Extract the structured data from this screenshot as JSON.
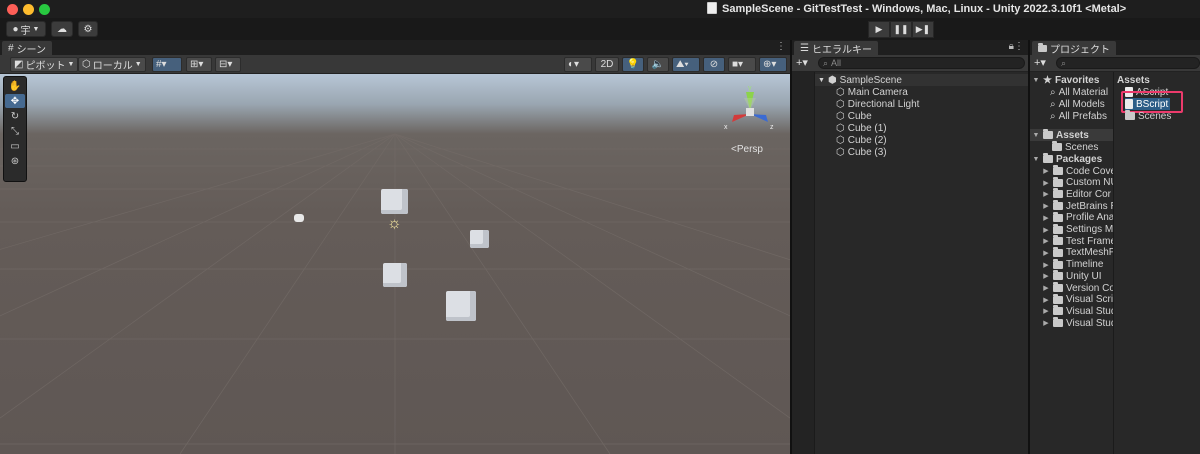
{
  "window": {
    "title": "SampleScene - GitTestTest - Windows, Mac, Linux - Unity 2022.3.10f1 <Metal>"
  },
  "toolbar": {
    "account_label": "宇"
  },
  "scene": {
    "tab_label": "シーン",
    "pivot_label": "ピボット",
    "local_label": "ローカル",
    "mode_2d": "2D",
    "persp_label": "<Persp"
  },
  "hierarchy": {
    "tab_label": "ヒエラルキー",
    "search_placeholder": "All",
    "scene_name": "SampleScene",
    "items": [
      "Main Camera",
      "Directional Light",
      "Cube",
      "Cube (1)",
      "Cube (2)",
      "Cube (3)"
    ]
  },
  "project": {
    "tab_label": "プロジェクト",
    "favorites_label": "Favorites",
    "favorites": [
      "All Material",
      "All Models",
      "All Prefabs"
    ],
    "assets_label": "Assets",
    "assets_children": [
      "Scenes"
    ],
    "packages_label": "Packages",
    "packages": [
      "Code Cove",
      "Custom NU",
      "Editor Cor",
      "JetBrains R",
      "Profile Ana",
      "Settings Ma",
      "Test Frame",
      "TextMeshP",
      "Timeline",
      "Unity UI",
      "Version Co",
      "Visual Scrip",
      "Visual Stud",
      "Visual Stud"
    ],
    "right_header": "Assets",
    "right_items": [
      "AScript",
      "BScript",
      "Scenes"
    ],
    "highlight_color": "#ec3b6c"
  }
}
